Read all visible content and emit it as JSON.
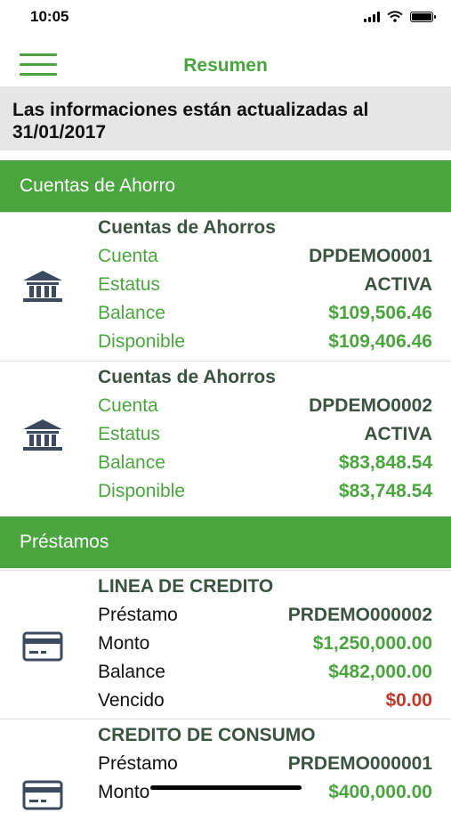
{
  "status_bar": {
    "time": "10:05"
  },
  "nav": {
    "title": "Resumen"
  },
  "banner": {
    "line1": "Las informaciones están actualizadas al",
    "date": "31/01/2017"
  },
  "savings": {
    "header": "Cuentas de Ahorro",
    "accounts": [
      {
        "icon": "bank-icon",
        "title": "Cuentas de Ahorros",
        "account_label": "Cuenta",
        "account_value": "DPDEMO0001",
        "status_label": "Estatus",
        "status_value": "ACTIVA",
        "balance_label": "Balance",
        "balance_value": "$109,506.46",
        "available_label": "Disponible",
        "available_value": "$109,406.46"
      },
      {
        "icon": "bank-icon",
        "title": "Cuentas de Ahorros",
        "account_label": "Cuenta",
        "account_value": "DPDEMO0002",
        "status_label": "Estatus",
        "status_value": "ACTIVA",
        "balance_label": "Balance",
        "balance_value": "$83,848.54",
        "available_label": "Disponible",
        "available_value": "$83,748.54"
      }
    ]
  },
  "loans": {
    "header": "Préstamos",
    "items": [
      {
        "icon": "credit-card-icon",
        "title": "LINEA DE CREDITO",
        "loan_label": "Préstamo",
        "loan_value": "PRDEMO000002",
        "amount_label": "Monto",
        "amount_value": "$1,250,000.00",
        "balance_label": "Balance",
        "balance_value": "$482,000.00",
        "overdue_label": "Vencido",
        "overdue_value": "$0.00"
      },
      {
        "icon": "credit-card-icon",
        "title": "CREDITO DE CONSUMO",
        "loan_label": "Préstamo",
        "loan_value": "PRDEMO000001",
        "amount_label": "Monto",
        "amount_value": "$400,000.00"
      }
    ]
  },
  "colors": {
    "accent": "#4aa53f",
    "dark_green": "#3a5441",
    "overdue": "#c0392b",
    "banner_bg": "#e6e6e6"
  }
}
